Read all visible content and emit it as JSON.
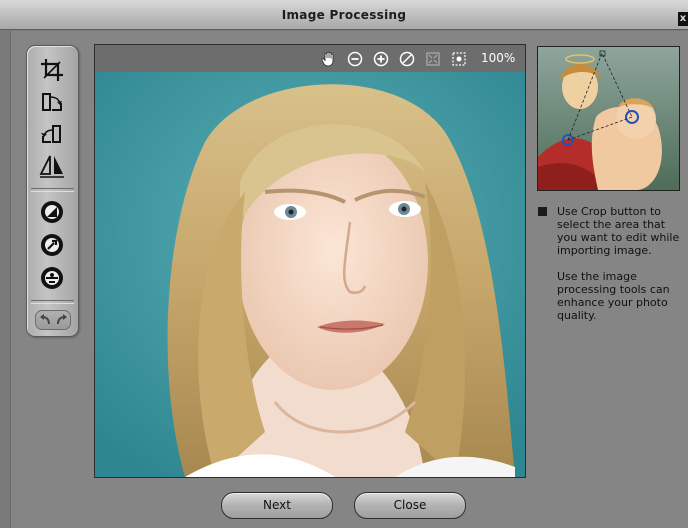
{
  "window": {
    "title": "Image Processing",
    "close_glyph": "x"
  },
  "toolbar": {
    "tools": [
      {
        "name": "crop-icon"
      },
      {
        "name": "rotate-right-icon"
      },
      {
        "name": "rotate-left-icon"
      },
      {
        "name": "flip-icon"
      },
      {
        "name": "contrast-icon"
      },
      {
        "name": "sharpen-icon"
      },
      {
        "name": "color-balance-icon"
      }
    ],
    "undo": {
      "name": "undo-icon"
    },
    "redo": {
      "name": "redo-icon"
    }
  },
  "viewer": {
    "tools": [
      {
        "name": "hand-icon"
      },
      {
        "name": "zoom-out-icon"
      },
      {
        "name": "zoom-in-icon"
      },
      {
        "name": "reset-icon"
      },
      {
        "name": "fit-icon"
      },
      {
        "name": "actual-size-icon"
      }
    ],
    "zoom_label": "100%"
  },
  "info": {
    "paragraphs": [
      "Use Crop button to select the area that you want to edit while importing image.",
      "Use the image processing tools can enhance your photo quality."
    ]
  },
  "buttons": {
    "next": "Next",
    "close": "Close"
  },
  "colors": {
    "background": "#858585",
    "canvas_bg": "#4aa1aa",
    "titlebar": "#c6c6c6"
  }
}
